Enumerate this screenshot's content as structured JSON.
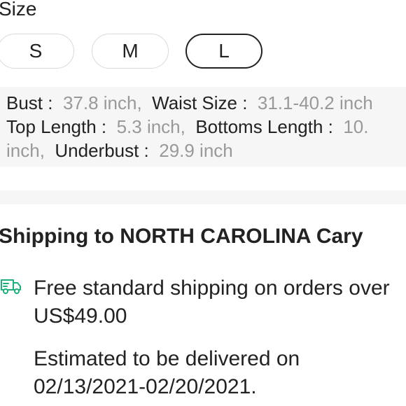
{
  "size_section": {
    "heading": "Size",
    "options": [
      {
        "label": "S",
        "selected": false
      },
      {
        "label": "M",
        "selected": false
      },
      {
        "label": "L",
        "selected": true
      }
    ]
  },
  "measurements": {
    "line1": {
      "bust_label": "Bust :",
      "bust_value": "37.8 inch,",
      "waist_label": "Waist Size :",
      "waist_value": "31.1-40.2 inch"
    },
    "line2": {
      "top_length_label": "Top Length :",
      "top_length_value": "5.3 inch,",
      "bottoms_length_label": "Bottoms Length :",
      "bottoms_length_value": "10."
    },
    "line3": {
      "bottoms_length_value_cont": "inch,",
      "underbust_label": "Underbust :",
      "underbust_value": "29.9 inch"
    }
  },
  "shipping": {
    "title": "Shipping to NORTH CAROLINA Cary",
    "icon": "delivery-truck-icon",
    "free_shipping_text": "Free standard shipping on orders over US$49.00",
    "estimate_text": "Estimated to be delivered on 02/13/2021-02/20/2021."
  },
  "colors": {
    "accent_green": "#1bb07a",
    "selected_border": "#222222",
    "muted_value": "#999999",
    "panel_bg": "#f6f6f6"
  }
}
